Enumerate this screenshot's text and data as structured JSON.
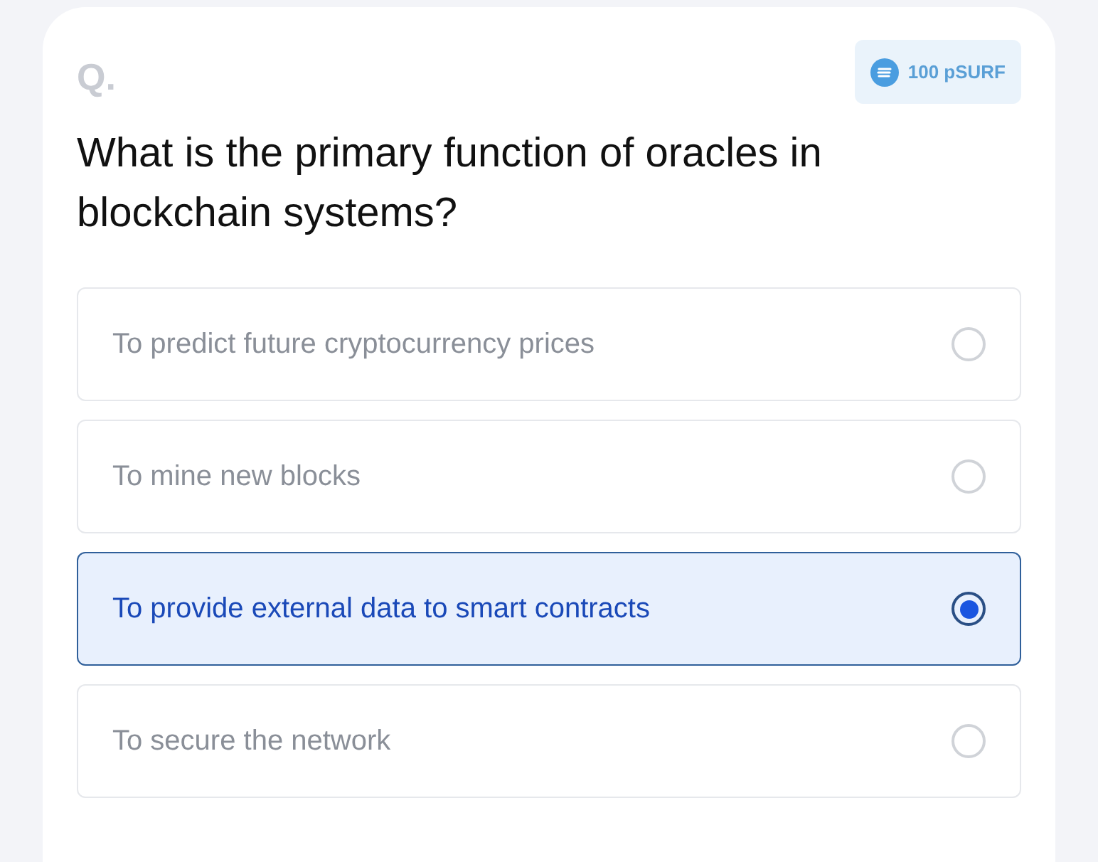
{
  "question": {
    "marker": "Q.",
    "reward": "100 pSURF",
    "text": "What is the primary function of oracles in blockchain systems?"
  },
  "options": [
    {
      "label": "To predict future cryptocurrency prices",
      "selected": false
    },
    {
      "label": "To mine new blocks",
      "selected": false
    },
    {
      "label": "To provide external data to smart contracts",
      "selected": true
    },
    {
      "label": "To secure the network",
      "selected": false
    }
  ]
}
